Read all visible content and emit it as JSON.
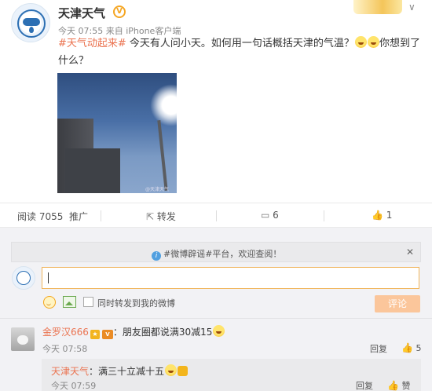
{
  "post": {
    "username": "天津天气",
    "meta": "今天 07:55 来自 iPhone客户端",
    "topic": "#天气动起来#",
    "text": " 今天有人问小天。如何用一句话概括天津的气温？",
    "text_tail": "你想到了什么？",
    "photo_watermark": "@天津天气",
    "icons": {
      "verified": "verified-v-icon",
      "menu": "chevron-down-icon"
    }
  },
  "actions": {
    "read_label": "阅读 7055",
    "promote_label": "推广",
    "repost_label": "转发",
    "comment_count": "6",
    "like_count": "1"
  },
  "comments": {
    "notice": "#微博辟谣#平台，欢迎查阅！",
    "forward_label": "同时转发到我的微博",
    "submit_label": "评论",
    "items": [
      {
        "user": "金罗汉666",
        "text": "：朋友圈都说满30减15",
        "time": "今天 07:58",
        "reply_label": "回复",
        "likes": "5"
      }
    ],
    "replies": [
      {
        "user": "天津天气",
        "text": "：满三十立减十五",
        "time": "今天 07:59",
        "reply_label": "回复",
        "like_label": "赞"
      }
    ]
  },
  "colors": {
    "accent": "#eb7350",
    "submit_bg": "#fbc69b",
    "input_border": "#f0b45a"
  }
}
